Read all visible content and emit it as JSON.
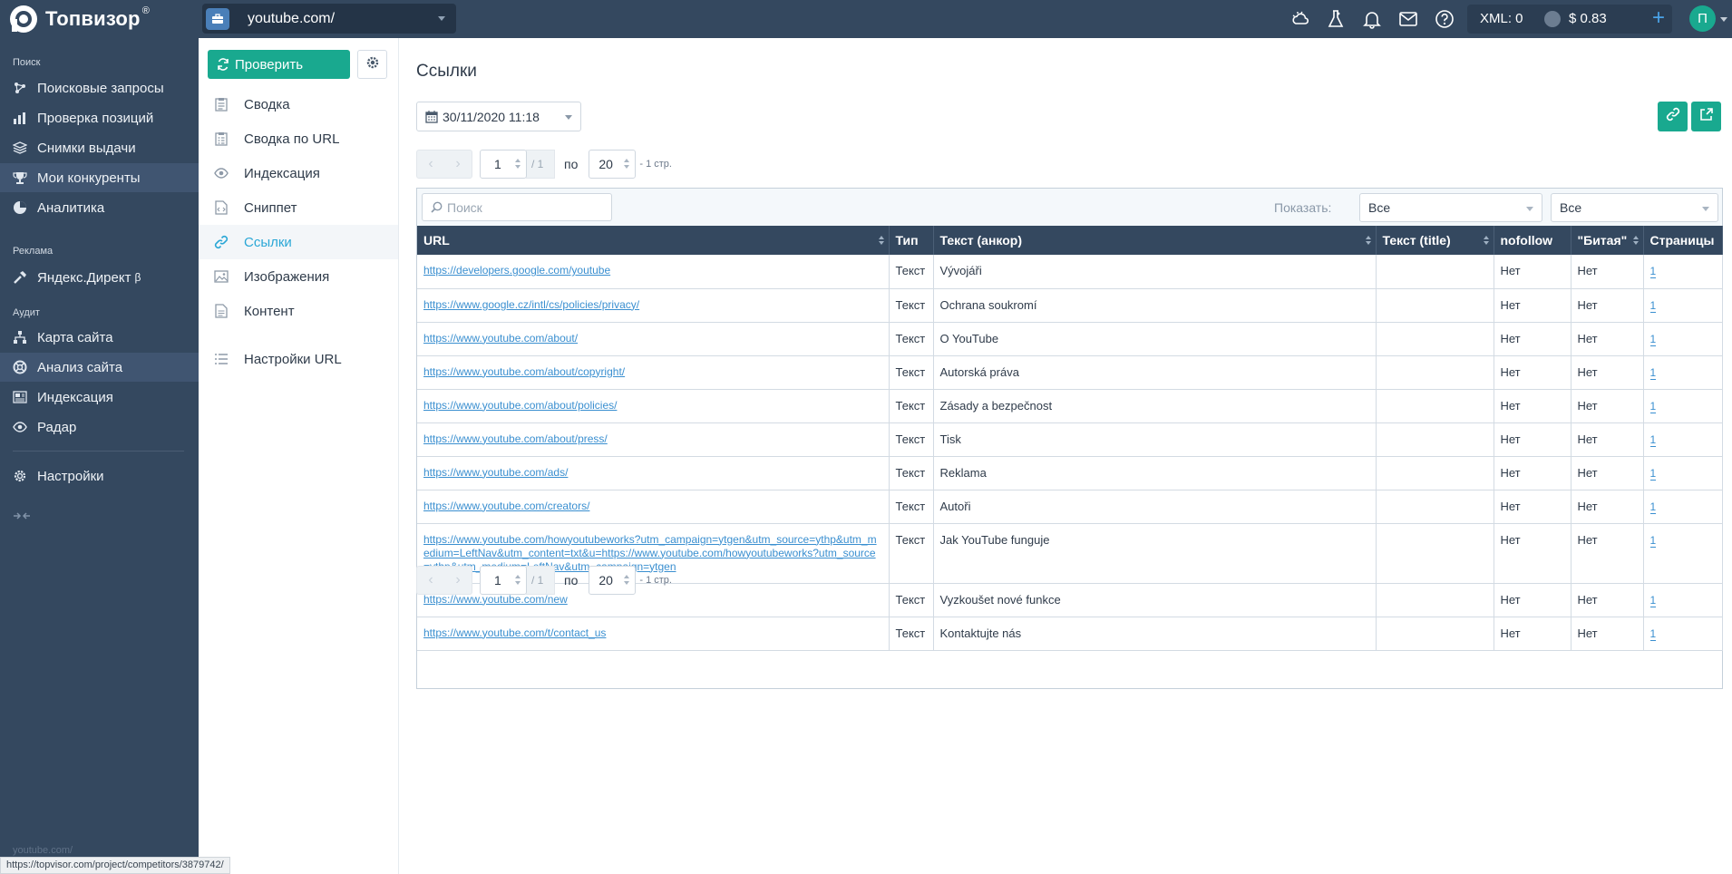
{
  "app": {
    "name": "Топвизор",
    "reg": "®"
  },
  "project": {
    "name": "youtube.com/"
  },
  "topbar": {
    "xml": "XML: 0",
    "balance": "$ 0.83",
    "plus": "+",
    "avatar": "П"
  },
  "sidebar": {
    "sections": [
      {
        "title": "Поиск",
        "items": [
          "Поисковые запросы",
          "Проверка позиций",
          "Снимки выдачи",
          "Мои конкуренты",
          "Аналитика"
        ]
      },
      {
        "title": "Реклама",
        "items": [
          "Яндекс.Директ"
        ]
      },
      {
        "title": "Аудит",
        "items": [
          "Карта сайта",
          "Анализ сайта",
          "Индексация",
          "Радар"
        ]
      }
    ],
    "direct_beta": "β",
    "settings": "Настройки",
    "footer": "youtube.com/"
  },
  "subnav": {
    "check_button": "Проверить",
    "items": [
      "Сводка",
      "Сводка по URL",
      "Индексация",
      "Сниппет",
      "Ссылки",
      "Изображения",
      "Контент"
    ],
    "url_settings": "Настройки URL"
  },
  "main": {
    "title": "Ссылки",
    "date": "30/11/2020 11:18",
    "pager": {
      "page": "1",
      "total": "/ 1",
      "po": "по",
      "size": "20",
      "pages": "- 1 стр."
    },
    "filter": {
      "search_placeholder": "Поиск",
      "show_label": "Показать:",
      "select1": "Все",
      "select2": "Все"
    },
    "columns": [
      "URL",
      "Тип",
      "Текст (анкор)",
      "Текст (title)",
      "nofollow",
      "\"Битая\"",
      "Страницы"
    ],
    "rows": [
      {
        "url": "https://developers.google.com/youtube",
        "type": "Текст",
        "anchor": "Vývojáři",
        "title": "",
        "nofollow": "Нет",
        "broken": "Нет",
        "pages": "1"
      },
      {
        "url": "https://www.google.cz/intl/cs/policies/privacy/",
        "type": "Текст",
        "anchor": "Ochrana soukromí",
        "title": "",
        "nofollow": "Нет",
        "broken": "Нет",
        "pages": "1"
      },
      {
        "url": "https://www.youtube.com/about/",
        "type": "Текст",
        "anchor": "O YouTube",
        "title": "",
        "nofollow": "Нет",
        "broken": "Нет",
        "pages": "1"
      },
      {
        "url": "https://www.youtube.com/about/copyright/",
        "type": "Текст",
        "anchor": "Autorská práva",
        "title": "",
        "nofollow": "Нет",
        "broken": "Нет",
        "pages": "1"
      },
      {
        "url": "https://www.youtube.com/about/policies/",
        "type": "Текст",
        "anchor": "Zásady a bezpečnost",
        "title": "",
        "nofollow": "Нет",
        "broken": "Нет",
        "pages": "1"
      },
      {
        "url": "https://www.youtube.com/about/press/",
        "type": "Текст",
        "anchor": "Tisk",
        "title": "",
        "nofollow": "Нет",
        "broken": "Нет",
        "pages": "1"
      },
      {
        "url": "https://www.youtube.com/ads/",
        "type": "Текст",
        "anchor": "Reklama",
        "title": "",
        "nofollow": "Нет",
        "broken": "Нет",
        "pages": "1"
      },
      {
        "url": "https://www.youtube.com/creators/",
        "type": "Текст",
        "anchor": "Autoři",
        "title": "",
        "nofollow": "Нет",
        "broken": "Нет",
        "pages": "1"
      },
      {
        "url": "https://www.youtube.com/howyoutubeworks?utm_campaign=ytgen&utm_source=ythp&utm_medium=LeftNav&utm_content=txt&u=https://www.youtube.com/howyoutubeworks?utm_source=ythp&utm_medium=LeftNav&utm_campaign=ytgen",
        "type": "Текст",
        "anchor": "Jak YouTube funguje",
        "title": "",
        "nofollow": "Нет",
        "broken": "Нет",
        "pages": "1"
      },
      {
        "url": "https://www.youtube.com/new",
        "type": "Текст",
        "anchor": "Vyzkoušet nové funkce",
        "title": "",
        "nofollow": "Нет",
        "broken": "Нет",
        "pages": "1"
      },
      {
        "url": "https://www.youtube.com/t/contact_us",
        "type": "Текст",
        "anchor": "Kontaktujte nás",
        "title": "",
        "nofollow": "Нет",
        "broken": "Нет",
        "pages": "1"
      }
    ]
  },
  "status_url": "https://topvisor.com/project/competitors/3879742/",
  "colors": {
    "nav_bg": "#34485f",
    "accent": "#19a98f",
    "link": "#3a8fd0",
    "active_link": "#2aa7d6"
  }
}
